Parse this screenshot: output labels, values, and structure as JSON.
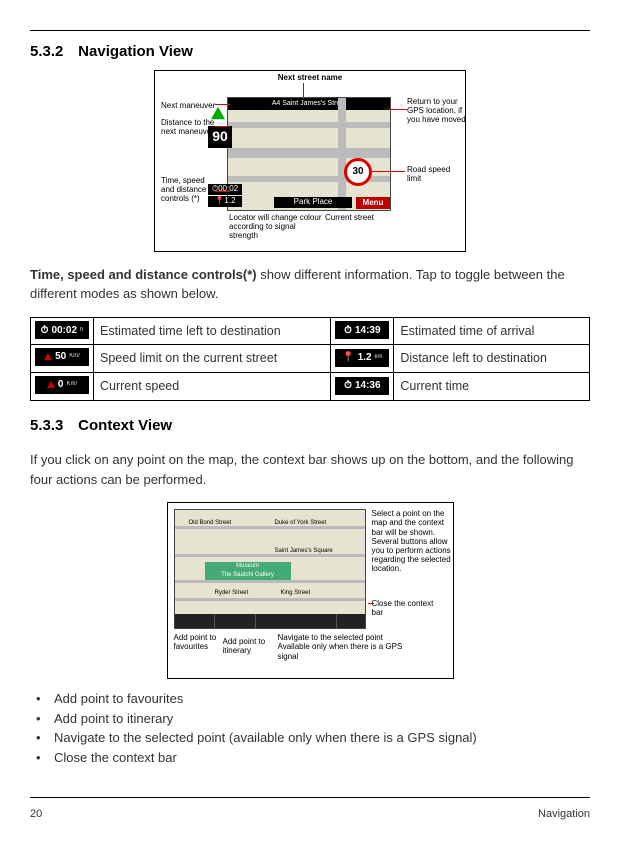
{
  "sections": {
    "nav_view": {
      "num": "5.3.2",
      "title": "Navigation View"
    },
    "ctx_view": {
      "num": "5.3.3",
      "title": "Context View"
    }
  },
  "fig1": {
    "nextStreetName": "Next street name",
    "nextManeuver": "Next maneuver",
    "distanceNext": "Distance to the\nnext maneuver",
    "timeSpeedDist": "Time, speed\nand distance\ncontrols (*)",
    "locator": "Locator will change colour\naccording to signal\nstrength",
    "currentStreet": "Current street",
    "returnGps": "Return to your\nGPS location, if\nyou have moved",
    "roadSpeed": "Road speed\nlimit",
    "map": {
      "topStreet": "A4  Saint James's Street",
      "speedBox": "90",
      "timeBox": "00:02",
      "distBox": "1.2",
      "limit": "30",
      "bottomStreet": "Park Place",
      "menu": "Menu"
    }
  },
  "nav_controls_para": {
    "lead": "Time, speed and distance controls(*)",
    "rest": " show different information. Tap to toggle between the different modes as shown below."
  },
  "table": {
    "r1c1": "00:02",
    "r1c1sub": "h",
    "r1c2": "Estimated time left to destination",
    "r1c3": "14:39",
    "r1c4": "Estimated time of arrival",
    "r2c1": "50",
    "r2c1sub": "Km/",
    "r2c2": "Speed limit on the current street",
    "r2c3": "1.2",
    "r2c3sub": "km",
    "r2c4": "Distance left to destination",
    "r3c1": "0",
    "r3c1sub": "Km/",
    "r3c2": "Current speed",
    "r3c3": "14:36",
    "r3c4": "Current time"
  },
  "ctx_para": "If you click on any point on the map, the context bar shows up on the bottom, and the following four actions can be performed.",
  "fig2": {
    "selectPoint": "Select a point on the\nmap and the context\nbar will be shown.\nSeveral buttons allow\nyou to perform actions\nregarding the selected\nlocation.",
    "closeBar": "Close the context\nbar",
    "addFav": "Add point to\nfavourites",
    "addItin": "Add point to\nitinerary",
    "navSel": "Navigate to the selected point\nAvailable only when there is a GPS\nsignal",
    "poi": "Museum\nThe Saatchi Gallery",
    "streets": {
      "a": "Old Bond Street",
      "b": "Duke of York Street",
      "c": "Saint James's Square",
      "d": "Ryder Street",
      "e": "King Street"
    }
  },
  "bullets": {
    "b1": "Add point to favourites",
    "b2": "Add point to itinerary",
    "b3": "Navigate to the selected point (available only when there is a GPS signal)",
    "b4": "Close the context bar"
  },
  "footer": {
    "page": "20",
    "chapter": "Navigation"
  }
}
